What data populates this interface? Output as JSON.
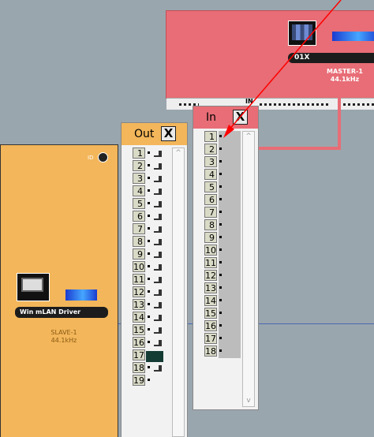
{
  "master": {
    "name": "01X",
    "label": "MASTER-1",
    "rate": "44.1kHz",
    "in_label": "IN"
  },
  "slave": {
    "name": "Win mLAN Driver",
    "label": "SLAVE-1",
    "rate": "44.1kHz",
    "id_label": "ID"
  },
  "out_window": {
    "title": "Out",
    "close": "X",
    "ports": [
      "1",
      "2",
      "3",
      "4",
      "5",
      "6",
      "7",
      "8",
      "9",
      "10",
      "11",
      "12",
      "13",
      "14",
      "15",
      "16",
      "17",
      "18",
      "19"
    ]
  },
  "in_window": {
    "title": "In",
    "close": "X",
    "ports": [
      "1",
      "2",
      "3",
      "4",
      "5",
      "6",
      "7",
      "8",
      "9",
      "10",
      "11",
      "12",
      "13",
      "14",
      "15",
      "16",
      "17",
      "18"
    ]
  },
  "colors": {
    "slave_orange": "#f3b65a",
    "master_red": "#e86d76",
    "background": "#9aa6ad",
    "arrow_red": "#ff0000"
  },
  "icons": {
    "master": "mixer-device-icon",
    "slave": "computer-icon",
    "arrow": "pointer-arrow"
  }
}
